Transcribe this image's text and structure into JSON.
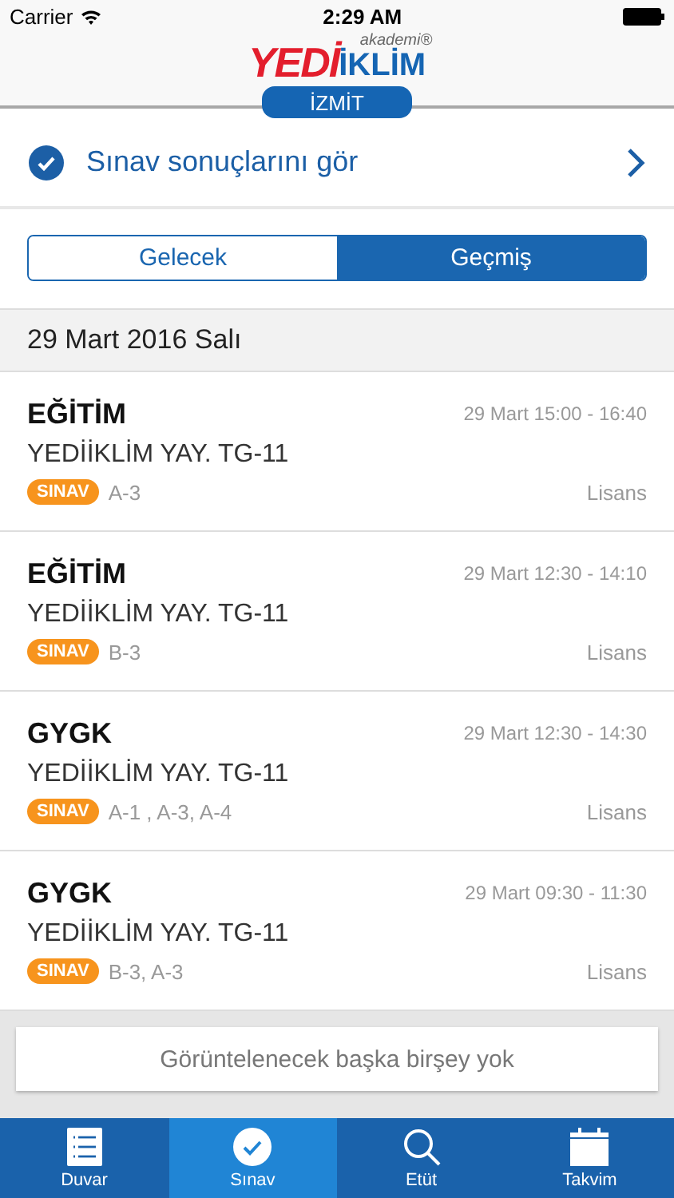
{
  "status_bar": {
    "carrier": "Carrier",
    "time": "2:29 AM"
  },
  "header": {
    "logo": {
      "part_red": "YEDİ",
      "part_blue": "İKLİM",
      "tagline": "akademi®"
    },
    "branch": "İZMİT"
  },
  "results_link": {
    "label": "Sınav sonuçlarını gör"
  },
  "segments": [
    {
      "label": "Gelecek",
      "selected": false
    },
    {
      "label": "Geçmiş",
      "selected": true
    }
  ],
  "date_header": "29 Mart 2016 Salı",
  "events": [
    {
      "title": "EĞİTİM",
      "time": "29 Mart 15:00 - 16:40",
      "subtitle": "YEDİİKLİM YAY. TG-11",
      "tag": "SINAV",
      "rooms": "A-3",
      "level": "Lisans"
    },
    {
      "title": "EĞİTİM",
      "time": "29 Mart 12:30 - 14:10",
      "subtitle": "YEDİİKLİM YAY. TG-11",
      "tag": "SINAV",
      "rooms": "B-3",
      "level": "Lisans"
    },
    {
      "title": "GYGK",
      "time": "29 Mart 12:30 - 14:30",
      "subtitle": "YEDİİKLİM YAY. TG-11",
      "tag": "SINAV",
      "rooms": "A-1 , A-3, A-4",
      "level": "Lisans"
    },
    {
      "title": "GYGK",
      "time": "29 Mart 09:30 - 11:30",
      "subtitle": "YEDİİKLİM YAY. TG-11",
      "tag": "SINAV",
      "rooms": "B-3, A-3",
      "level": "Lisans"
    }
  ],
  "end_message": "Görüntelenecek başka birşey yok",
  "tab_bar": [
    {
      "label": "Duvar",
      "kind": "list",
      "selected": false
    },
    {
      "label": "Sınav",
      "kind": "check",
      "selected": true
    },
    {
      "label": "Etüt",
      "kind": "search",
      "selected": false
    },
    {
      "label": "Takvim",
      "kind": "calendar",
      "selected": false
    }
  ]
}
